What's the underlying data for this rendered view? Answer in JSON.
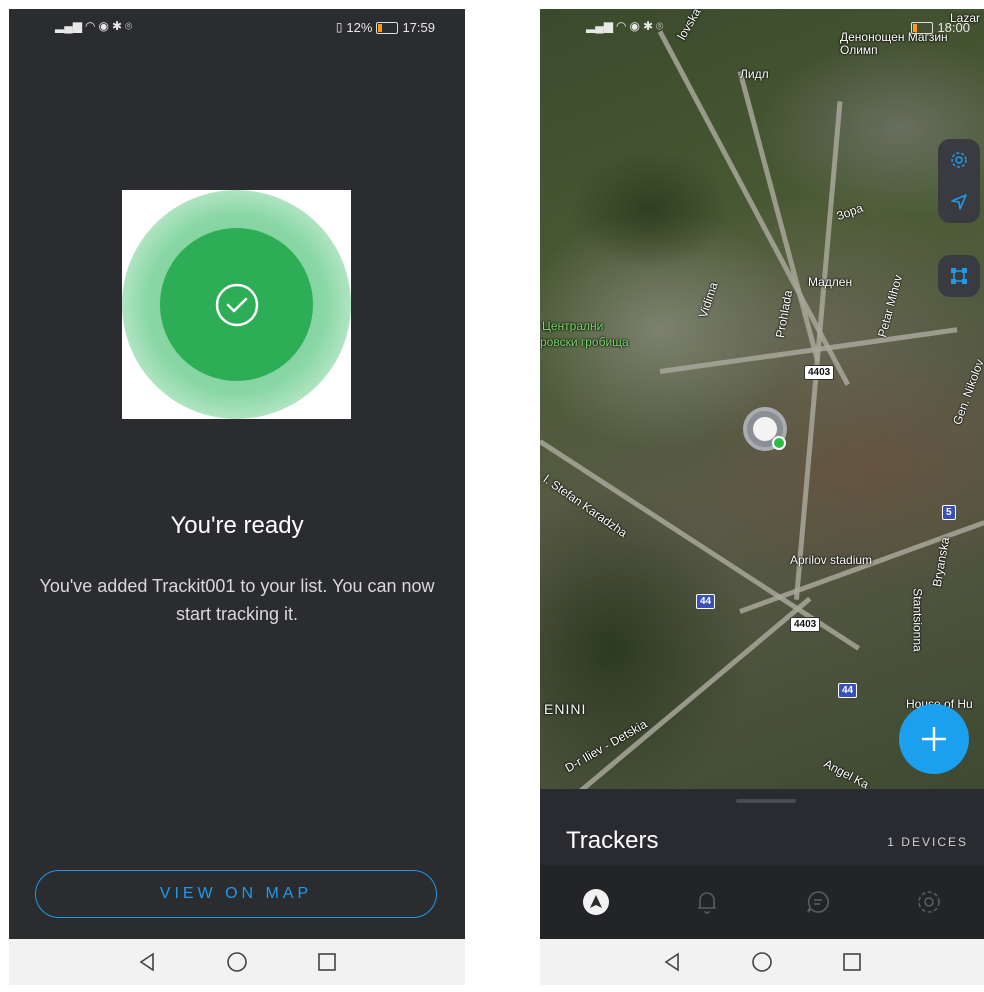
{
  "left": {
    "status": {
      "battery": "12%",
      "time": "17:59"
    },
    "title": "You're ready",
    "description": "You've added Trackit001 to your list. You can now start tracking it.",
    "button": "VIEW ON MAP"
  },
  "right": {
    "status": {
      "time": "18:00"
    },
    "map": {
      "labels": {
        "lidl": "Лидл",
        "olimp": "Денонощен Магзин Олимп",
        "zora": "Зора",
        "madlen": "Мадлен",
        "petar_mihov": "Petar Mihov",
        "prohlada": "Prohlada",
        "vidima": "Vidima",
        "cemetery_1": "Централни",
        "cemetery_2": "ровски гробища",
        "stefan": "l. Stefan Karadzha",
        "aprilov": "Aprilov stadium",
        "stantsionna": "Stantsionna",
        "bryanska": "Bryanska",
        "nikolov": "Gen. Nikolov",
        "enini": "ENINI",
        "detskia": "D-r Iliev - Detskia",
        "angel": "Angel Ka",
        "house": "House of Hu",
        "lazar": "Lazar",
        "ovska": "lovska"
      },
      "shields": {
        "r4403a": "4403",
        "r4403b": "4403",
        "r44a": "44",
        "r44b": "44",
        "r5": "5"
      }
    },
    "sheet": {
      "title": "Trackers",
      "count": "1 DEVICES"
    }
  }
}
